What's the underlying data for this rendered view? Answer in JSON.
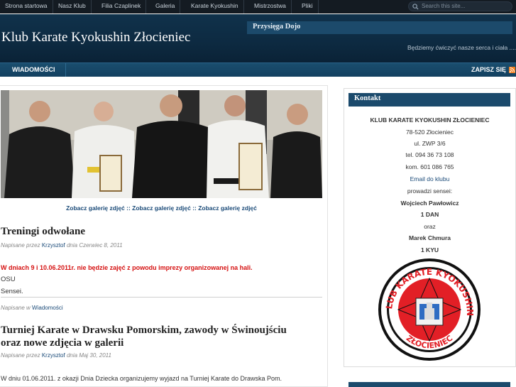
{
  "topnav": {
    "items": [
      "Strona startowa",
      "Nasz Klub",
      "Filia Czaplinek",
      "Galeria",
      "Karate Kyokushin",
      "Mistrzostwa",
      "Pliki"
    ],
    "search_placeholder": "Search this site..."
  },
  "header": {
    "site_title": "Klub Karate Kyokushin Złocieniec",
    "feature_title": "Przysięga Dojo",
    "feature_excerpt": "Będziemy ćwiczyć nasze serca i ciała ...."
  },
  "catbar": {
    "category": "WIADOMOŚCI",
    "subscribe": "ZAPISZ SIĘ"
  },
  "gallery_links": "Zobacz galerię zdjęć :: Zobacz galerię zdjęć :: Zobacz galerię zdjęć",
  "posts": [
    {
      "title": "Treningi odwołane",
      "meta_prefix": "Napisane przez",
      "author": "Krzysztof",
      "meta_date": "dnia Czerwiec 8, 2011",
      "highlight": "W dniach 9 i 10.06.2011r. nie będzie zajęć z powodu imprezy organizowanej na hali.",
      "lines": [
        "OSU",
        "Sensei."
      ],
      "category_prefix": "Napisane w",
      "category": "Wiadomości"
    },
    {
      "title_line1": "Turniej Karate w Drawsku Pomorskim, zawody w Świnoujściu",
      "title_line2": "oraz nowe zdjęcia w galerii",
      "meta_prefix": "Napisane przez",
      "author": "Krzysztof",
      "meta_date": "dnia Maj 30, 2011",
      "excerpt": "W dniu 01.06.2011. z okazji Dnia Dziecka organizujemy wyjazd na Turniej Karate do Drawska Pom."
    }
  ],
  "sidebar": {
    "widget_title": "Kontakt",
    "club_name": "KLUB KARATE KYOKUSHIN ZŁOCIENIEC",
    "postal": "78-520 Złocieniec",
    "street": "ul. ZWP 3/6",
    "phone": "tel. 094 36 73 108",
    "mobile": "kom. 601 086 765",
    "email_link": "Email do klubu",
    "led_by": "prowadzi sensei:",
    "sensei1": "Wojciech Pawłowicz",
    "rank1": "1 DAN",
    "and": "oraz",
    "sensei2": "Marek Chmura",
    "rank2": "1 KYU",
    "logo_text_top": "KLUB KARATE KYOKUSHIN",
    "logo_text_bottom": "ZŁOCIENIEC"
  },
  "colors": {
    "topnav_bg": "#141b22",
    "header_bg": "#0d2a41",
    "accent_blue": "#1b4a6c",
    "link": "#1a4a78",
    "alert_red": "#d51111",
    "logo_red": "#e21f26"
  }
}
